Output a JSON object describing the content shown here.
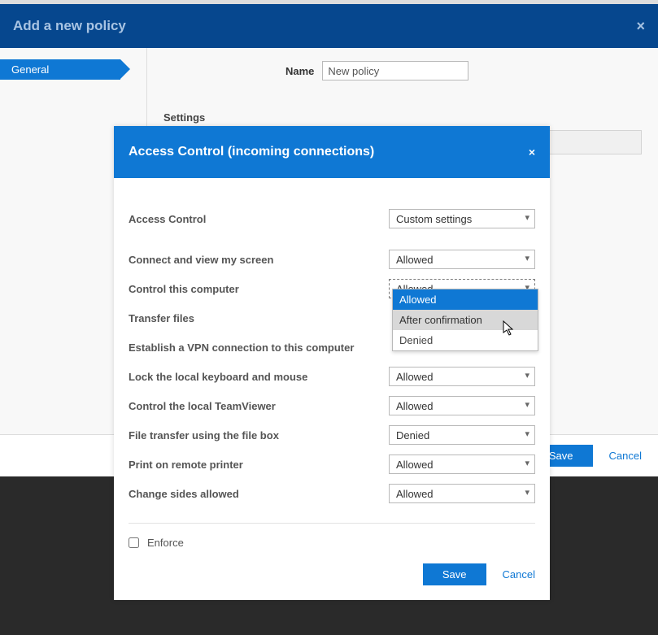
{
  "header": {
    "title": "Add a new policy",
    "close_glyph": "×"
  },
  "sidebar": {
    "tabs": [
      "General"
    ]
  },
  "form": {
    "name_label": "Name",
    "name_value": "New policy",
    "settings_heading": "Settings"
  },
  "main_footer": {
    "save": "Save",
    "cancel": "Cancel"
  },
  "modal": {
    "title": "Access Control (incoming connections)",
    "close_glyph": "×",
    "rows": {
      "access_control": {
        "label": "Access Control",
        "value": "Custom settings"
      },
      "connect_view": {
        "label": "Connect and view my screen",
        "value": "Allowed"
      },
      "control_comp": {
        "label": "Control this computer",
        "value": "Allowed"
      },
      "transfer_files": {
        "label": "Transfer files",
        "value": ""
      },
      "vpn": {
        "label": "Establish a VPN connection to this computer",
        "value": ""
      },
      "lock_km": {
        "label": "Lock the local keyboard and mouse",
        "value": "Allowed"
      },
      "control_tv": {
        "label": "Control the local TeamViewer",
        "value": "Allowed"
      },
      "file_box": {
        "label": "File transfer using the file box",
        "value": "Denied"
      },
      "print": {
        "label": "Print on remote printer",
        "value": "Allowed"
      },
      "change_sides": {
        "label": "Change sides allowed",
        "value": "Allowed"
      }
    },
    "dropdown_options": [
      "Allowed",
      "After confirmation",
      "Denied"
    ],
    "enforce_label": "Enforce",
    "enforce_checked": false,
    "save": "Save",
    "cancel": "Cancel"
  }
}
